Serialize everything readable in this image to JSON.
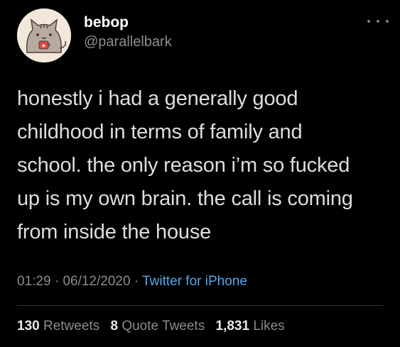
{
  "tweet": {
    "display_name": "bebop",
    "handle": "@parallelbark",
    "avatar_icon": "pusheen-cat-avatar",
    "more_icon": "more-horizontal-icon",
    "text_lines": [
      "honestly i had a generally good",
      "childhood in terms of family and",
      "school. the only reason i’m so fucked",
      "up is my own brain. the call is coming",
      "from inside the house"
    ],
    "time": "01:29",
    "separator": " · ",
    "date": "06/12/2020",
    "source": "Twitter for iPhone",
    "stats": {
      "retweets_count": "130",
      "retweets_label": " Retweets",
      "quote_count": "8",
      "quote_label": " Quote Tweets",
      "likes_count": "1,831",
      "likes_label": " Likes"
    }
  },
  "colors": {
    "background": "#000000",
    "text": "#dddddd",
    "secondary": "#878b90",
    "link": "#4ea8ec"
  }
}
